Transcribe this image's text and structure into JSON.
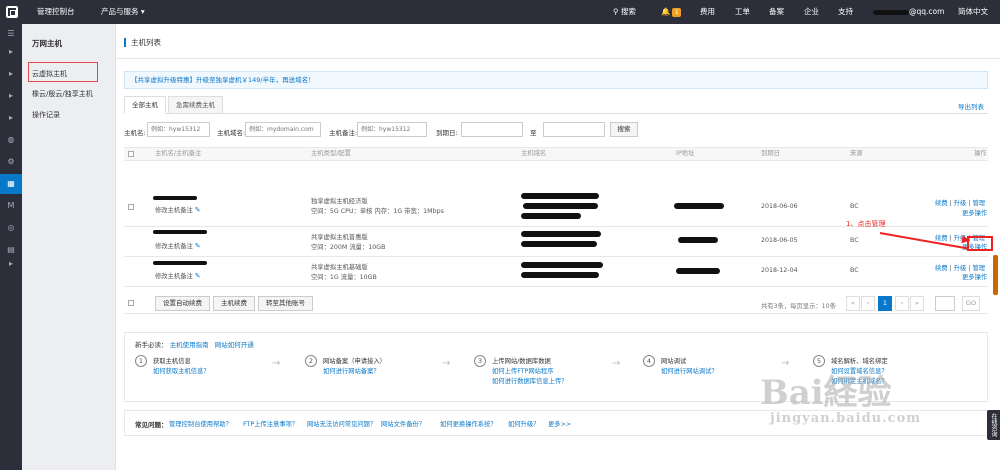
{
  "topbar": {
    "console": "管理控制台",
    "products": "产品与服务",
    "search": "搜索",
    "notifications": "1",
    "fees": "费用",
    "tickets": "工单",
    "beian": "备案",
    "enterprise": "企业",
    "support": "支持",
    "account": "@qq.com",
    "language": "简体中文"
  },
  "subnav": {
    "title": "万网主机",
    "items": [
      "云虚拟主机",
      "橡云/殷云/独享主机",
      "操作记录"
    ]
  },
  "main": {
    "title": "主机列表",
    "notice": "【共享虚拟升级特惠】升级至独享虚机￥149/半年，再送域名！",
    "tabs": [
      "全部主机",
      "急需续费主机"
    ],
    "export": "导出列表",
    "filters": {
      "host_name_label": "主机名:",
      "host_name_ph": "例如：hyw15312",
      "domain_label": "主机域名:",
      "domain_ph": "例如：mydomain.com",
      "remark_label": "主机备注:",
      "remark_ph": "例如：hyw15312",
      "expire_label": "到期日:",
      "to_label": "至",
      "search_btn": "搜索"
    },
    "table": {
      "headers": [
        "主机名/主机备注",
        "主机类型/配置",
        "主机域名",
        "IP地址",
        "到期日",
        "来源",
        "操作"
      ],
      "rows": [
        {
          "remark": "修改主机备注",
          "type": "独享虚拟主机经济版",
          "config": "空间：5G CPU：单核 内存：1G 带宽：1Mbps",
          "date": "2018-06-06",
          "source": "BC",
          "ops": [
            "续费",
            "升级",
            "管理"
          ],
          "more": "更多操作"
        },
        {
          "remark": "修改主机备注",
          "type": "共享虚拟主机普惠版",
          "config": "空间：200M 流量：10GB",
          "date": "2018-06-05",
          "source": "BC",
          "ops": [
            "续费",
            "升级",
            "管理"
          ],
          "more": "更多操作"
        },
        {
          "remark": "修改主机备注",
          "type": "共享虚拟主机基础版",
          "config": "空间：1G 流量：10GB",
          "date": "2018-12-04",
          "source": "BC",
          "ops": [
            "续费",
            "升级",
            "管理"
          ],
          "more": "更多操作"
        }
      ]
    },
    "footer": {
      "btns": [
        "设置自动续费",
        "主机续费",
        "转至其他账号"
      ],
      "summary": "共有3条，每页显示：10条",
      "pages": [
        "«",
        "‹",
        "1",
        "›",
        "»"
      ],
      "go": "GO"
    },
    "guide": {
      "title_prefix": "新手必读：",
      "title_links": [
        "主机使用指南",
        "网站如何开通"
      ],
      "steps": [
        {
          "num": "1",
          "title": "获取主机信息",
          "links": [
            "如何获取主机信息？"
          ]
        },
        {
          "num": "2",
          "title": "网站备案（申请接入）",
          "links": [
            "如何进行网站备案？"
          ]
        },
        {
          "num": "3",
          "title": "上传网站/数据库数据",
          "links": [
            "如何上传FTP网站程序",
            "如何进行数据库信息上传？"
          ]
        },
        {
          "num": "4",
          "title": "网站调试",
          "links": [
            "如何进行网站调试？"
          ]
        },
        {
          "num": "5",
          "title": "域名解析、域名绑定",
          "links": [
            "如何设置域名信息？",
            "如何绑定主机域名？"
          ]
        }
      ]
    },
    "faq": {
      "label": "常见问题：",
      "links": [
        "管理控制台使用帮助？",
        "FTP上传注意事项？",
        "网站无法访问常见问题？",
        "网站文件备份？",
        "如何更换操作系统？",
        "如何升级？",
        "更多>>"
      ]
    }
  },
  "annotation": {
    "text": "1、点击管理"
  },
  "watermark": {
    "text": "Bai経验",
    "sub": "jingyan.baidu.com"
  },
  "side_tab": "在线咨询"
}
